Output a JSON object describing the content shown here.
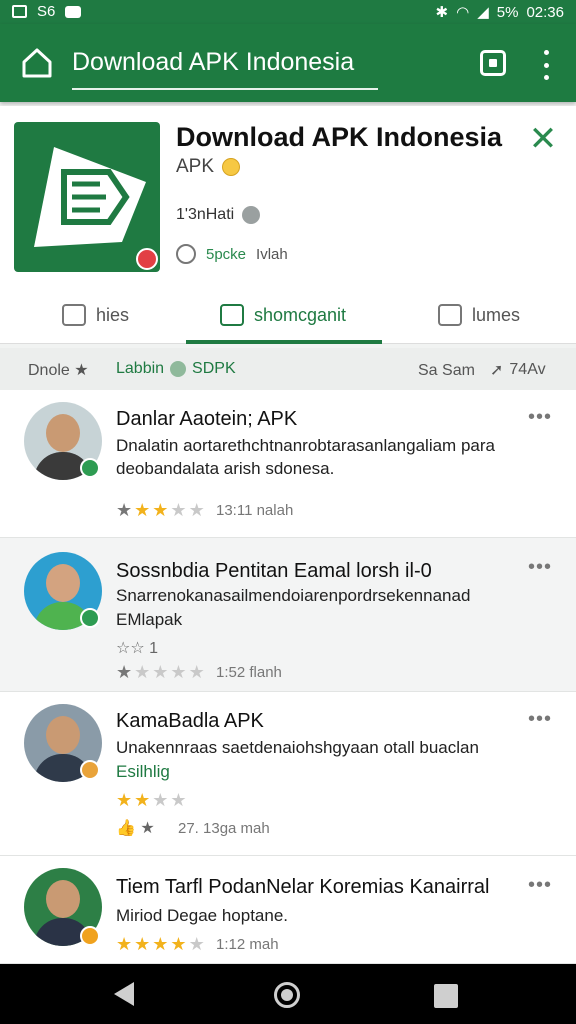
{
  "status_bar": {
    "battery": "5%",
    "time": "02:36",
    "left_text": "S6"
  },
  "app_bar": {
    "title": "Download APK Indonesia"
  },
  "app": {
    "name": "Download APK Indonesia",
    "category": "APK",
    "meta_line": "1'3nHati",
    "likes": "5pcke",
    "likes_suffix": "Ivlah"
  },
  "tabs": [
    {
      "label": "hies"
    },
    {
      "label": "shomcganit"
    },
    {
      "label": "lumes"
    }
  ],
  "filter": {
    "left": "Dnole ★",
    "tag": "Labbin",
    "tag_suffix": "SDPK",
    "sort": "Sa Sam",
    "count": "74Av"
  },
  "items": [
    {
      "title": "Danlar Aaotein; APK",
      "text": "Dnalatin aortarethchtnanrobtarasanlangaliam para deobandalata arish sdonesa.",
      "rating": 2,
      "time": "13:11 nalah",
      "colors": {
        "bg": "#c7d3d6",
        "body": "#3a3a3a",
        "badge": "#2e9c52"
      }
    },
    {
      "title": "Sossnbdia Pentitan Eamal lorsh il-0",
      "text": "Snarrenokanasailmendoiarenpordrsekennanad",
      "text2": "EMlapak",
      "sub": "☆☆ 1",
      "rating": 0,
      "time": "1:52 flanh",
      "colors": {
        "bg": "#2d9fd0",
        "body": "#4fb34f",
        "badge": "#2e9c52"
      }
    },
    {
      "title": "KamaBadla  APK",
      "text": "Unakennraas saetdenaiohshgyaan otall buaclan",
      "text2": "Esilhlig",
      "rating": 2,
      "time": "27. 13ga mah",
      "colors": {
        "bg": "#8a9ba8",
        "body": "#2f3a4a",
        "badge": "#e9a33a"
      }
    },
    {
      "title": "Tiem Tarfl PodanNelar Koremias Kanairral",
      "text": "Miriod Degae hoptane.",
      "rating": 3.5,
      "time": "1:12 mah",
      "colors": {
        "bg": "#2d7f46",
        "body": "#2a3346",
        "badge": "#f0a21e"
      }
    }
  ]
}
